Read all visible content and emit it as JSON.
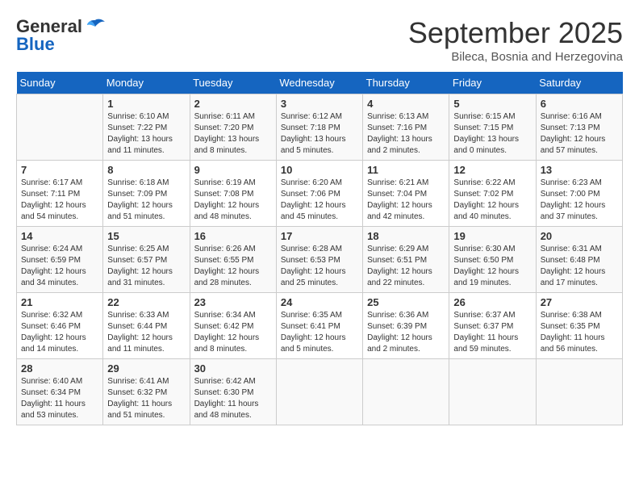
{
  "header": {
    "logo_general": "General",
    "logo_blue": "Blue",
    "month_title": "September 2025",
    "subtitle": "Bileca, Bosnia and Herzegovina"
  },
  "weekdays": [
    "Sunday",
    "Monday",
    "Tuesday",
    "Wednesday",
    "Thursday",
    "Friday",
    "Saturday"
  ],
  "weeks": [
    [
      {
        "day": "",
        "info": ""
      },
      {
        "day": "1",
        "info": "Sunrise: 6:10 AM\nSunset: 7:22 PM\nDaylight: 13 hours\nand 11 minutes."
      },
      {
        "day": "2",
        "info": "Sunrise: 6:11 AM\nSunset: 7:20 PM\nDaylight: 13 hours\nand 8 minutes."
      },
      {
        "day": "3",
        "info": "Sunrise: 6:12 AM\nSunset: 7:18 PM\nDaylight: 13 hours\nand 5 minutes."
      },
      {
        "day": "4",
        "info": "Sunrise: 6:13 AM\nSunset: 7:16 PM\nDaylight: 13 hours\nand 2 minutes."
      },
      {
        "day": "5",
        "info": "Sunrise: 6:15 AM\nSunset: 7:15 PM\nDaylight: 13 hours\nand 0 minutes."
      },
      {
        "day": "6",
        "info": "Sunrise: 6:16 AM\nSunset: 7:13 PM\nDaylight: 12 hours\nand 57 minutes."
      }
    ],
    [
      {
        "day": "7",
        "info": "Sunrise: 6:17 AM\nSunset: 7:11 PM\nDaylight: 12 hours\nand 54 minutes."
      },
      {
        "day": "8",
        "info": "Sunrise: 6:18 AM\nSunset: 7:09 PM\nDaylight: 12 hours\nand 51 minutes."
      },
      {
        "day": "9",
        "info": "Sunrise: 6:19 AM\nSunset: 7:08 PM\nDaylight: 12 hours\nand 48 minutes."
      },
      {
        "day": "10",
        "info": "Sunrise: 6:20 AM\nSunset: 7:06 PM\nDaylight: 12 hours\nand 45 minutes."
      },
      {
        "day": "11",
        "info": "Sunrise: 6:21 AM\nSunset: 7:04 PM\nDaylight: 12 hours\nand 42 minutes."
      },
      {
        "day": "12",
        "info": "Sunrise: 6:22 AM\nSunset: 7:02 PM\nDaylight: 12 hours\nand 40 minutes."
      },
      {
        "day": "13",
        "info": "Sunrise: 6:23 AM\nSunset: 7:00 PM\nDaylight: 12 hours\nand 37 minutes."
      }
    ],
    [
      {
        "day": "14",
        "info": "Sunrise: 6:24 AM\nSunset: 6:59 PM\nDaylight: 12 hours\nand 34 minutes."
      },
      {
        "day": "15",
        "info": "Sunrise: 6:25 AM\nSunset: 6:57 PM\nDaylight: 12 hours\nand 31 minutes."
      },
      {
        "day": "16",
        "info": "Sunrise: 6:26 AM\nSunset: 6:55 PM\nDaylight: 12 hours\nand 28 minutes."
      },
      {
        "day": "17",
        "info": "Sunrise: 6:28 AM\nSunset: 6:53 PM\nDaylight: 12 hours\nand 25 minutes."
      },
      {
        "day": "18",
        "info": "Sunrise: 6:29 AM\nSunset: 6:51 PM\nDaylight: 12 hours\nand 22 minutes."
      },
      {
        "day": "19",
        "info": "Sunrise: 6:30 AM\nSunset: 6:50 PM\nDaylight: 12 hours\nand 19 minutes."
      },
      {
        "day": "20",
        "info": "Sunrise: 6:31 AM\nSunset: 6:48 PM\nDaylight: 12 hours\nand 17 minutes."
      }
    ],
    [
      {
        "day": "21",
        "info": "Sunrise: 6:32 AM\nSunset: 6:46 PM\nDaylight: 12 hours\nand 14 minutes."
      },
      {
        "day": "22",
        "info": "Sunrise: 6:33 AM\nSunset: 6:44 PM\nDaylight: 12 hours\nand 11 minutes."
      },
      {
        "day": "23",
        "info": "Sunrise: 6:34 AM\nSunset: 6:42 PM\nDaylight: 12 hours\nand 8 minutes."
      },
      {
        "day": "24",
        "info": "Sunrise: 6:35 AM\nSunset: 6:41 PM\nDaylight: 12 hours\nand 5 minutes."
      },
      {
        "day": "25",
        "info": "Sunrise: 6:36 AM\nSunset: 6:39 PM\nDaylight: 12 hours\nand 2 minutes."
      },
      {
        "day": "26",
        "info": "Sunrise: 6:37 AM\nSunset: 6:37 PM\nDaylight: 11 hours\nand 59 minutes."
      },
      {
        "day": "27",
        "info": "Sunrise: 6:38 AM\nSunset: 6:35 PM\nDaylight: 11 hours\nand 56 minutes."
      }
    ],
    [
      {
        "day": "28",
        "info": "Sunrise: 6:40 AM\nSunset: 6:34 PM\nDaylight: 11 hours\nand 53 minutes."
      },
      {
        "day": "29",
        "info": "Sunrise: 6:41 AM\nSunset: 6:32 PM\nDaylight: 11 hours\nand 51 minutes."
      },
      {
        "day": "30",
        "info": "Sunrise: 6:42 AM\nSunset: 6:30 PM\nDaylight: 11 hours\nand 48 minutes."
      },
      {
        "day": "",
        "info": ""
      },
      {
        "day": "",
        "info": ""
      },
      {
        "day": "",
        "info": ""
      },
      {
        "day": "",
        "info": ""
      }
    ]
  ]
}
